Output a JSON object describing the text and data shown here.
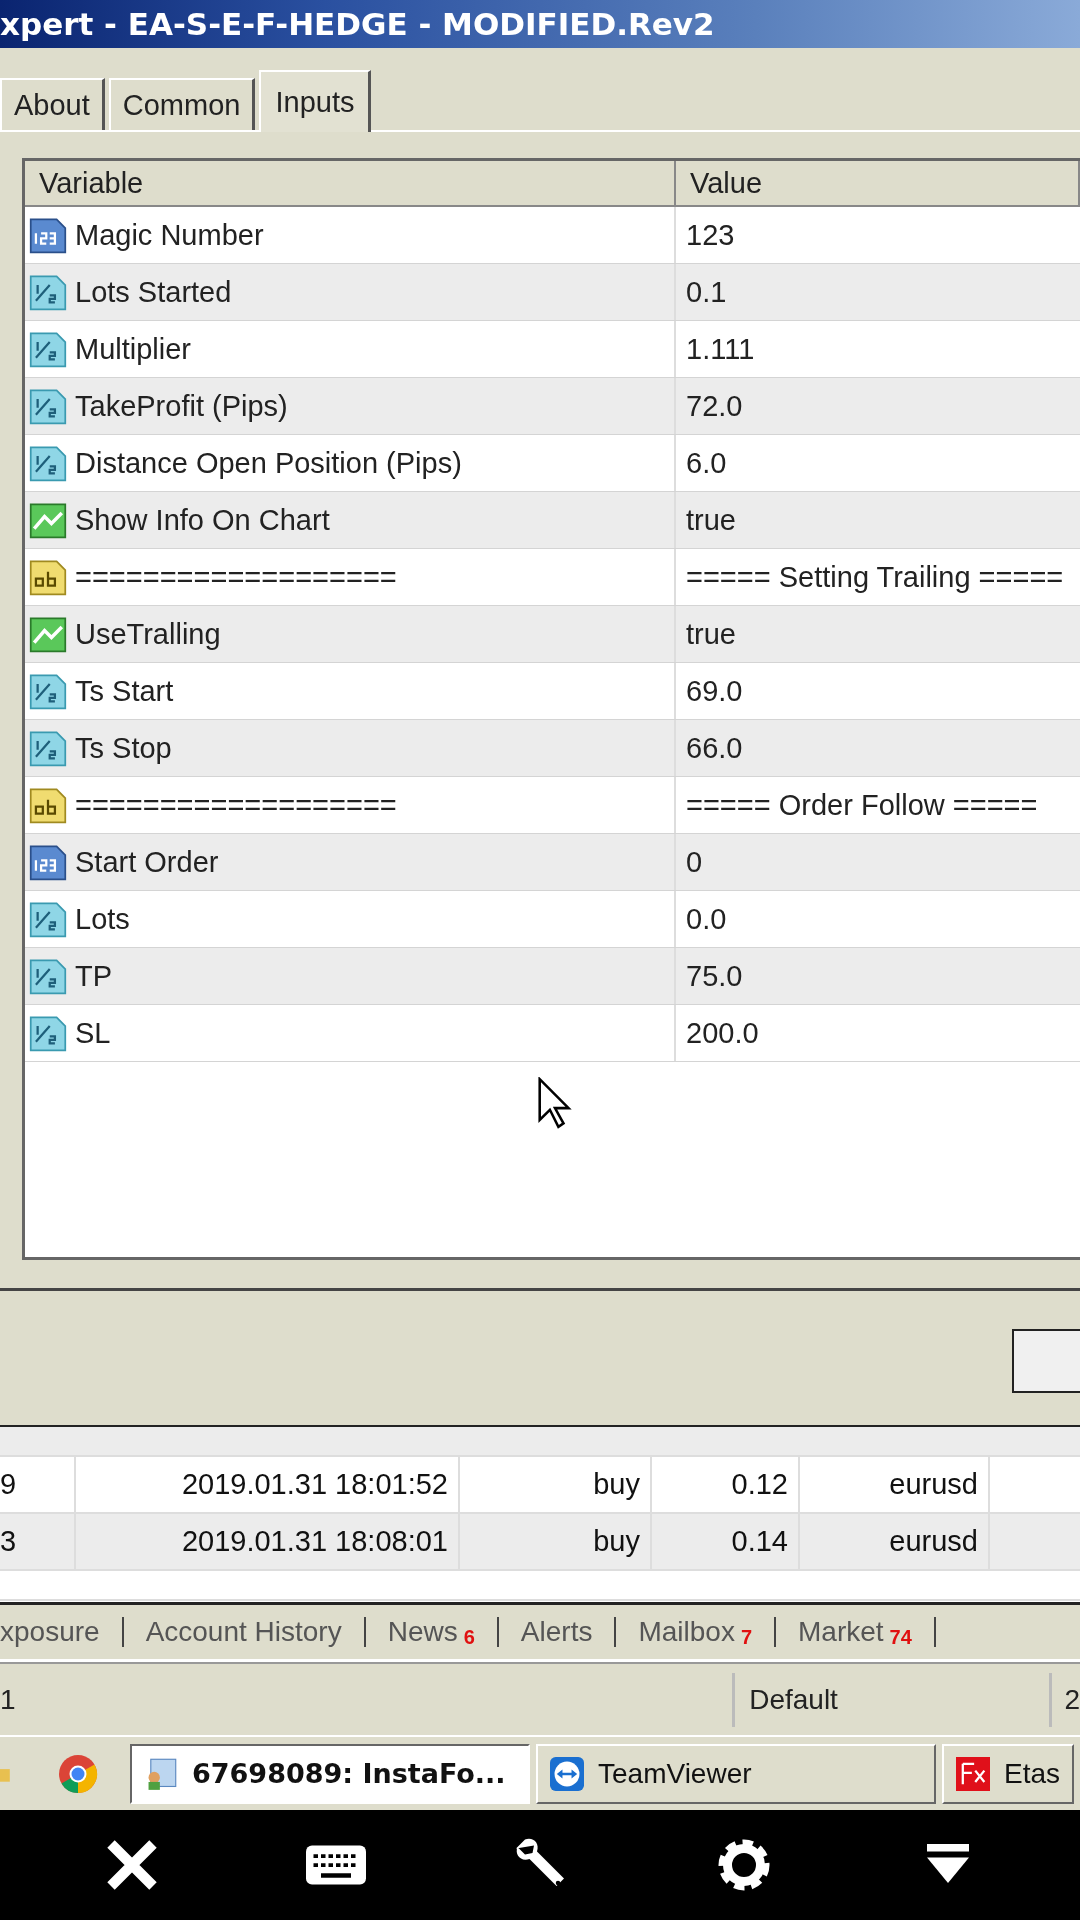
{
  "window": {
    "title": "xpert - EA-S-E-F-HEDGE - MODIFIED.Rev2"
  },
  "tabs": [
    {
      "label": "About",
      "selected": false
    },
    {
      "label": "Common",
      "selected": false
    },
    {
      "label": "Inputs",
      "selected": true
    }
  ],
  "inputs": {
    "columns": [
      "Variable",
      "Value"
    ],
    "rows": [
      {
        "kind": "int",
        "variable": "Magic Number",
        "value": "123"
      },
      {
        "kind": "double",
        "variable": "Lots Started",
        "value": "0.1"
      },
      {
        "kind": "double",
        "variable": "Multiplier",
        "value": "1.111"
      },
      {
        "kind": "double",
        "variable": "TakeProfit (Pips)",
        "value": "72.0"
      },
      {
        "kind": "double",
        "variable": "Distance Open Position (Pips)",
        "value": "6.0"
      },
      {
        "kind": "bool",
        "variable": "Show Info On Chart",
        "value": "true"
      },
      {
        "kind": "string",
        "variable": "===================",
        "value": "===== Setting Trailing ====="
      },
      {
        "kind": "bool",
        "variable": "UseTralling",
        "value": "true"
      },
      {
        "kind": "double",
        "variable": "Ts Start",
        "value": "69.0"
      },
      {
        "kind": "double",
        "variable": "Ts Stop",
        "value": "66.0"
      },
      {
        "kind": "string",
        "variable": "===================",
        "value": "===== Order Follow ====="
      },
      {
        "kind": "int",
        "variable": "Start Order",
        "value": "0"
      },
      {
        "kind": "double",
        "variable": "Lots",
        "value": "0.0"
      },
      {
        "kind": "double",
        "variable": "TP",
        "value": "75.0"
      },
      {
        "kind": "double",
        "variable": "SL",
        "value": "200.0"
      }
    ]
  },
  "trades": {
    "rows": [
      {
        "id": "9",
        "time": "2019.01.31 18:01:52",
        "type": "buy",
        "size": "0.12",
        "symbol": "eurusd"
      },
      {
        "id": "3",
        "time": "2019.01.31 18:08:01",
        "type": "buy",
        "size": "0.14",
        "symbol": "eurusd"
      }
    ]
  },
  "terminal_tabs": [
    {
      "label": "xposure"
    },
    {
      "label": "Account History"
    },
    {
      "label": "News",
      "badge": "6"
    },
    {
      "label": "Alerts"
    },
    {
      "label": "Mailbox",
      "badge": "7"
    },
    {
      "label": "Market",
      "badge": "74"
    }
  ],
  "status_bar": [
    "1",
    "Default",
    "2"
  ],
  "taskbar": [
    {
      "kind": "terminal",
      "label": "67698089: InstaFo...",
      "selected": true
    },
    {
      "kind": "teamviewer",
      "label": "TeamViewer",
      "selected": false
    },
    {
      "kind": "fx",
      "label": "Etas",
      "selected": false
    }
  ]
}
